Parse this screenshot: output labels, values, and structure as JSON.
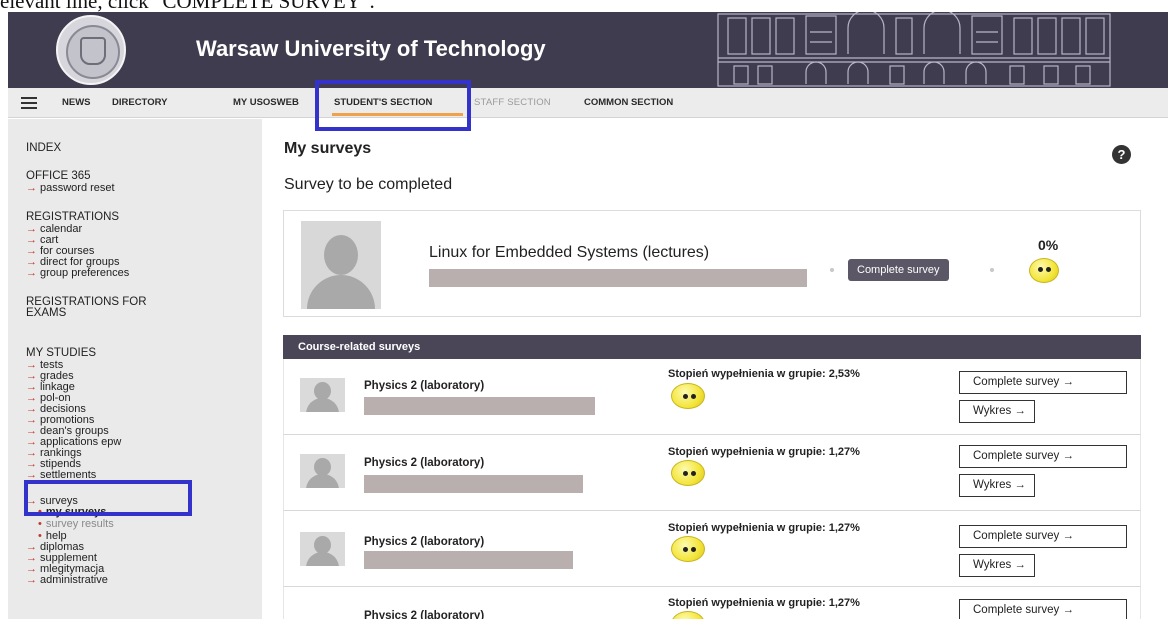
{
  "caption": {
    "text": "elevant line, click \"COMPLETE SURVEY\"."
  },
  "header": {
    "title": "Warsaw University of Technology"
  },
  "nav": {
    "items": [
      "NEWS",
      "DIRECTORY",
      "MY USOSWEB",
      "STUDENT'S SECTION",
      "STAFF SECTION",
      "COMMON SECTION"
    ]
  },
  "sidebar": {
    "index": "INDEX",
    "office": "OFFICE 365",
    "password_reset": "password reset",
    "registrations": "REGISTRATIONS",
    "reg_items": [
      "calendar",
      "cart",
      "for courses",
      "direct for groups",
      "group preferences"
    ],
    "reg_exams_1": "REGISTRATIONS FOR",
    "reg_exams_2": "EXAMS",
    "my_studies": "MY STUDIES",
    "study_items": [
      "tests",
      "grades",
      "linkage",
      "pol-on",
      "decisions",
      "promotions",
      "dean's groups",
      "applications epw",
      "rankings",
      "stipends",
      "settlements"
    ],
    "surveys": "surveys",
    "my_surveys": "my surveys",
    "survey_results": "survey results",
    "help": "help",
    "after_items": [
      "diplomas",
      "supplement",
      "mlegitymacja",
      "administrative"
    ],
    "arrow": "→",
    "dot": "•"
  },
  "main": {
    "title": "My surveys",
    "help_icon": "?",
    "subtitle": "Survey to be completed",
    "pending": {
      "course": "Linux for Embedded Systems (lectures)",
      "button": "Complete survey",
      "progress_label": "0%"
    },
    "course_surveys_header": "Course-related surveys",
    "rows": [
      {
        "course": "Physics 2 (laboratory)",
        "stat": "Stopień wypełnienia w grupie: 2,53%",
        "complete": "Complete survey  →",
        "chart": "Wykres  →"
      },
      {
        "course": "Physics 2 (laboratory)",
        "stat": "Stopień wypełnienia w grupie: 1,27%",
        "complete": "Complete survey  →",
        "chart": "Wykres  →"
      },
      {
        "course": "Physics 2 (laboratory)",
        "stat": "Stopień wypełnienia w grupie: 1,27%",
        "complete": "Complete survey  →",
        "chart": "Wykres  →"
      },
      {
        "course": "Physics 2 (laboratory)",
        "stat": "Stopień wypełnienia w grupie: 1,27%",
        "complete": "Complete survey  →"
      }
    ]
  },
  "colors": {
    "banner": "#3f3c4f",
    "highlight": "#3333cc",
    "active_tab_underline": "#f0a24a",
    "section_header": "#4a4658",
    "arrow": "#c0392b"
  }
}
